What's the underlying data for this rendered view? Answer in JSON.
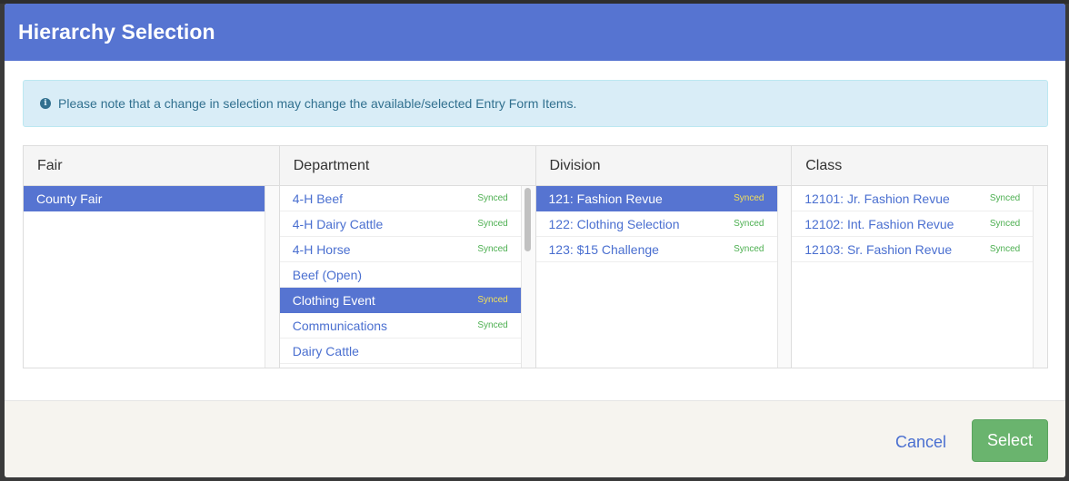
{
  "modal": {
    "title": "Hierarchy Selection"
  },
  "alert": {
    "text": "Please note that a change in selection may change the available/selected Entry Form Items.",
    "icon": "info-icon"
  },
  "columns": {
    "fair": {
      "header": "Fair",
      "items": [
        {
          "label": "County Fair",
          "badge": "",
          "active": true
        }
      ]
    },
    "department": {
      "header": "Department",
      "items": [
        {
          "label": "4-H Beef",
          "badge": "Synced",
          "active": false
        },
        {
          "label": "4-H Dairy Cattle",
          "badge": "Synced",
          "active": false
        },
        {
          "label": "4-H Horse",
          "badge": "Synced",
          "active": false
        },
        {
          "label": "Beef (Open)",
          "badge": "",
          "active": false
        },
        {
          "label": "Clothing Event",
          "badge": "Synced",
          "active": true
        },
        {
          "label": "Communications",
          "badge": "Synced",
          "active": false
        },
        {
          "label": "Dairy Cattle",
          "badge": "",
          "active": false
        }
      ]
    },
    "division": {
      "header": "Division",
      "items": [
        {
          "label": "121: Fashion Revue",
          "badge": "Synced",
          "active": true
        },
        {
          "label": "122: Clothing Selection",
          "badge": "Synced",
          "active": false
        },
        {
          "label": "123: $15 Challenge",
          "badge": "Synced",
          "active": false
        }
      ]
    },
    "class": {
      "header": "Class",
      "items": [
        {
          "label": "12101: Jr. Fashion Revue",
          "badge": "Synced",
          "active": false
        },
        {
          "label": "12102: Int. Fashion Revue",
          "badge": "Synced",
          "active": false
        },
        {
          "label": "12103: Sr. Fashion Revue",
          "badge": "Synced",
          "active": false
        }
      ]
    }
  },
  "footer": {
    "cancel_label": "Cancel",
    "select_label": "Select"
  },
  "colors": {
    "header": "#5674d1",
    "active": "#5674d1",
    "synced": "#4caf50",
    "synced_active": "#f3e05a",
    "select_button": "#6ab46e",
    "alert_bg": "#d9edf7"
  }
}
